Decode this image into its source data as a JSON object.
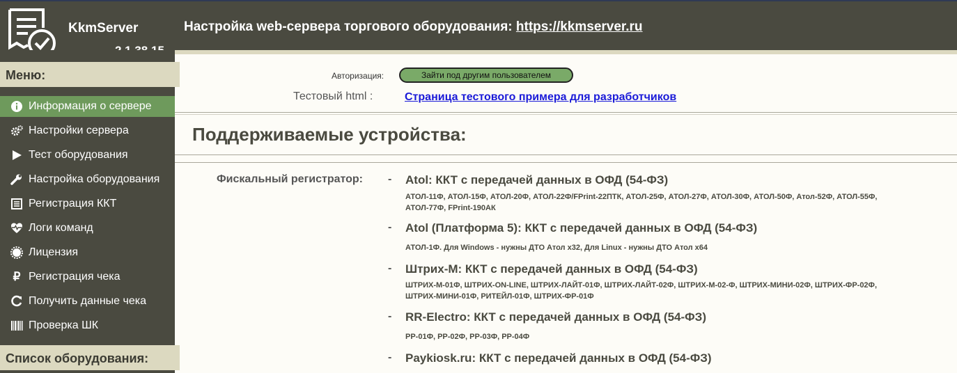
{
  "app": {
    "name": "KkmServer",
    "version": "2.1.38.15"
  },
  "header": {
    "title_prefix": "Настройка web-сервера торгового оборудования:",
    "link": "https://kkmserver.ru"
  },
  "sidebar": {
    "menu_title": "Меню:",
    "items": [
      {
        "label": "Информация о сервере",
        "icon": "info-icon",
        "active": true
      },
      {
        "label": "Настройки сервера",
        "icon": "gears-icon"
      },
      {
        "label": "Тест оборудования",
        "icon": "play-icon"
      },
      {
        "label": "Настройка оборудования",
        "icon": "wrench-icon"
      },
      {
        "label": "Регистрация ККТ",
        "icon": "list-icon"
      },
      {
        "label": "Логи команд",
        "icon": "heartbeat-icon"
      },
      {
        "label": "Лицензия",
        "icon": "certificate-icon"
      },
      {
        "label": "Регистрация чека",
        "icon": "ruble-icon"
      },
      {
        "label": "Получить данные чека",
        "icon": "refresh-icon"
      },
      {
        "label": "Проверка ШК",
        "icon": "barcode-icon"
      }
    ],
    "equipment_title": "Список оборудования:"
  },
  "main": {
    "auth_label": "Авторизация:",
    "auth_button": "Зайти под другим пользователем",
    "test_label": "Тестовый html :",
    "test_link": "Страница тестового примера для разработчиков",
    "section_title": "Поддерживаемые устройства:",
    "fiscal_label": "Фискальный регистратор:",
    "dash": "-",
    "devices": [
      {
        "title": "Atol: ККТ с передачей данных в ОФД (54-ФЗ)",
        "models": "АТОЛ-11Ф, АТОЛ-15Ф, АТОЛ-20Ф, АТОЛ-22Ф/FPrint-22ПТК, АТОЛ-25Ф, АТОЛ-27Ф, АТОЛ-30Ф, АТОЛ-50Ф, Атол-52Ф, АТОЛ-55Ф, АТОЛ-77Ф, FPrint-190АК"
      },
      {
        "title": "Atol (Платформа 5): ККТ с передачей данных в ОФД (54-ФЗ)",
        "models": "АТОЛ-1Ф. Для Windows - нужны ДТО Атол x32, Для Linux - нужны ДТО Атол x64"
      },
      {
        "title": "Штрих-М: ККТ с передачей данных в ОФД (54-ФЗ)",
        "models": "ШТРИХ-М-01Ф, ШТРИХ-ON-LINE, ШТРИХ-ЛАЙТ-01Ф, ШТРИХ-ЛАЙТ-02Ф, ШТРИХ-М-02-Ф, ШТРИХ-МИНИ-02Ф, ШТРИХ-ФР-02Ф, ШТРИХ-МИНИ-01Ф, РИТЕЙЛ-01Ф, ШТРИХ-ФР-01Ф"
      },
      {
        "title": "RR-Electro: ККТ с передачей данных в ОФД (54-ФЗ)",
        "models": "РР-01Ф, РР-02Ф, РР-03Ф, РР-04Ф"
      },
      {
        "title": "Paykiosk.ru: ККТ с передачей данных в ОФД (54-ФЗ)",
        "models": ""
      }
    ]
  }
}
